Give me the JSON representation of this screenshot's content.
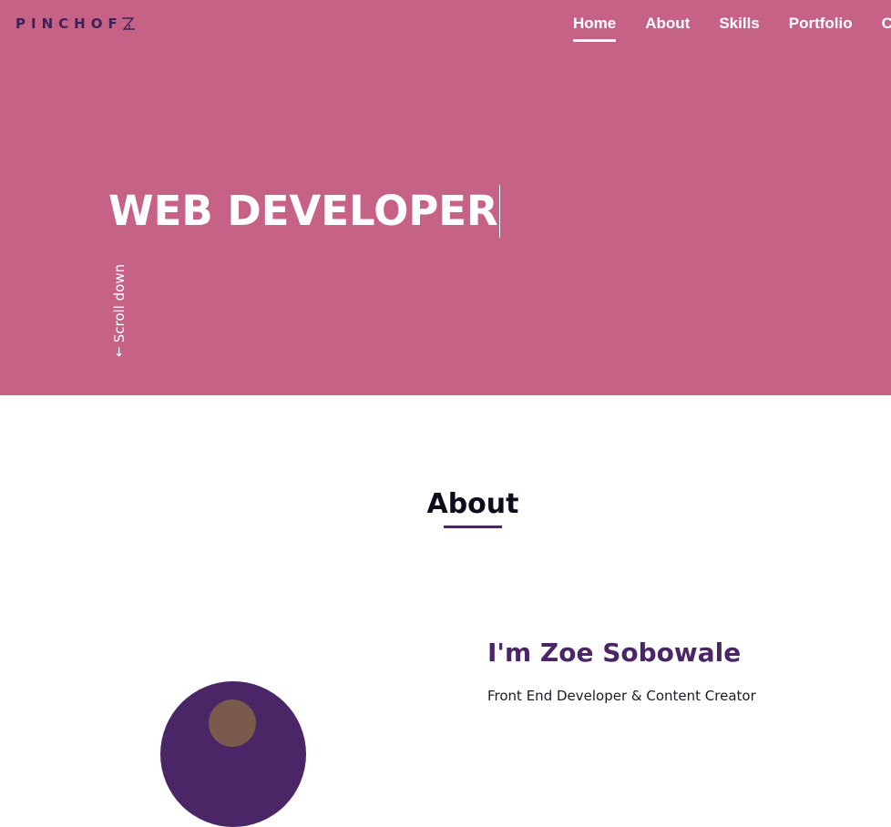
{
  "logo": {
    "text": "PINCHOF",
    "mark": "Z"
  },
  "nav": {
    "items": [
      {
        "label": "Home",
        "active": true
      },
      {
        "label": "About",
        "active": false
      },
      {
        "label": "Skills",
        "active": false
      },
      {
        "label": "Portfolio",
        "active": false
      },
      {
        "label": "C",
        "active": false
      }
    ]
  },
  "hero": {
    "title": "WEB DEVELOPER",
    "scroll_label": "Scroll down",
    "scroll_icon": "arrow-down-icon"
  },
  "about": {
    "heading": "About",
    "name": "I'm Zoe Sobowale",
    "role": "Front End Developer & Content Creator"
  },
  "colors": {
    "hero_bg": "#c76287",
    "accent": "#4a2666",
    "heading": "#0e0b1a",
    "white": "#ffffff"
  }
}
